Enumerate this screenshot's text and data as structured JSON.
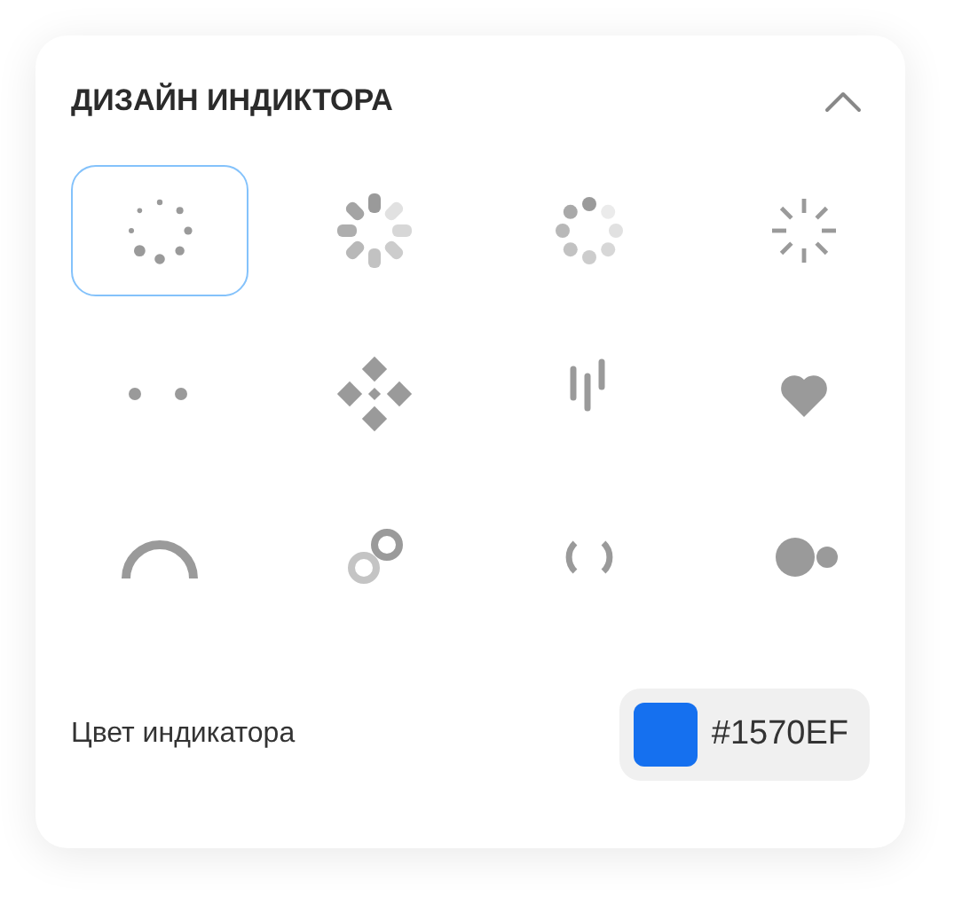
{
  "panel": {
    "title": "ДИЗАЙН ИНДИКТОРА",
    "expanded": true
  },
  "indicators": [
    {
      "kind": "dotring",
      "selected": true
    },
    {
      "kind": "petals",
      "selected": false
    },
    {
      "kind": "dotcircle",
      "selected": false
    },
    {
      "kind": "burst",
      "selected": false
    },
    {
      "kind": "twodots",
      "selected": false
    },
    {
      "kind": "diamonds",
      "selected": false
    },
    {
      "kind": "bars",
      "selected": false
    },
    {
      "kind": "heart",
      "selected": false
    },
    {
      "kind": "arc",
      "selected": false
    },
    {
      "kind": "rings",
      "selected": false
    },
    {
      "kind": "brackets",
      "selected": false
    },
    {
      "kind": "pulse",
      "selected": false
    }
  ],
  "color_setting": {
    "label": "Цвет индикатора",
    "value": "#1570EF",
    "color": "#1570ef"
  }
}
